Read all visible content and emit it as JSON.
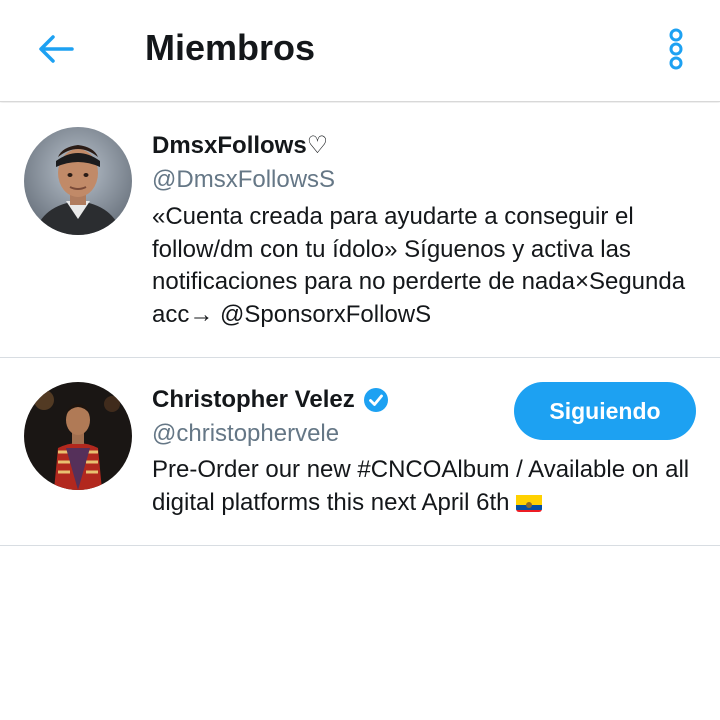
{
  "header": {
    "title": "Miembros",
    "back_icon": "arrow-left-icon",
    "menu_icon": "vertical-ellipsis-icon",
    "accent_color": "#1da1f2"
  },
  "members": [
    {
      "name": "DmsxFollows♡",
      "handle": "@DmsxFollowsS",
      "bio": "«Cuenta creada para ayudarte a conseguir el follow/dm con tu ídolo» Síguenos y activa las notificaciones para no perderte de nada×Segunda acc→ @SponsorxFollowS",
      "verified": false
    },
    {
      "name": "Christopher Velez",
      "handle": "@christophervele",
      "bio": "Pre-Order our new #CNCOAlbum / Available on all digital platforms this next April 6th",
      "bio_emoji": "ecuador-flag-icon",
      "verified": true,
      "follow_label": "Siguiendo"
    }
  ],
  "colors": {
    "text_primary": "#14171a",
    "text_secondary": "#657786",
    "button_bg": "#1da1f2",
    "divider": "#d8dde2"
  }
}
